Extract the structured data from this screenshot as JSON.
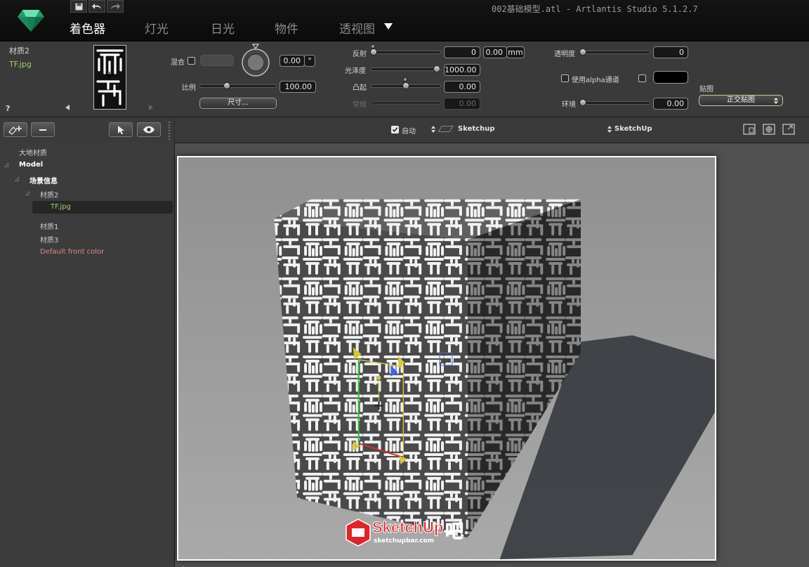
{
  "window": {
    "title": "002基础模型.atl - Artlantis Studio 5.1.2.7"
  },
  "tabs": [
    {
      "label": "着色器",
      "active": true
    },
    {
      "label": "灯光",
      "active": false
    },
    {
      "label": "日光",
      "active": false
    },
    {
      "label": "物件",
      "active": false
    },
    {
      "label": "透视图",
      "active": false
    }
  ],
  "material": {
    "name": "材质2",
    "texture": "TF.jpg",
    "help": "?",
    "blend_label": "混合",
    "angle_value": "0.00",
    "angle_unit": "°",
    "scale_label": "比例",
    "scale_value": "100.00",
    "size_button": "尺寸...",
    "reflection_label": "反射",
    "reflection_value": "0",
    "reflection_dist": "0.00",
    "reflection_unit": "mm",
    "gloss_label": "光泽度",
    "gloss_value": "1000.00",
    "bump_label": "凸起",
    "bump_value": "0.00",
    "normal_label": "常规",
    "normal_value": "0.00",
    "transparency_label": "透明度",
    "transparency_value": "0",
    "alpha_label": "使用alpha通道",
    "ambient_label": "环境",
    "ambient_value": "0.00",
    "mapping_label": "贴图",
    "mapping_value": "正交贴图"
  },
  "viewport": {
    "auto_label": "自动",
    "source_label": "Sketchup",
    "engine_label": "SketchUp"
  },
  "tree": {
    "ground": "大地材质",
    "model": "Model",
    "scene": "场景信息",
    "mat2": "材质2",
    "texture": "TF.jpg",
    "mat1": "材质1",
    "mat3": "材质3",
    "default_color": "Default front color"
  },
  "watermark": {
    "brand": "SketchUp",
    "char": "吧",
    "site": "sketchupbar.com"
  },
  "colors": {
    "accent": "#9bd36a",
    "default_color": "#d88a8a",
    "watermark": "#e0242b"
  }
}
